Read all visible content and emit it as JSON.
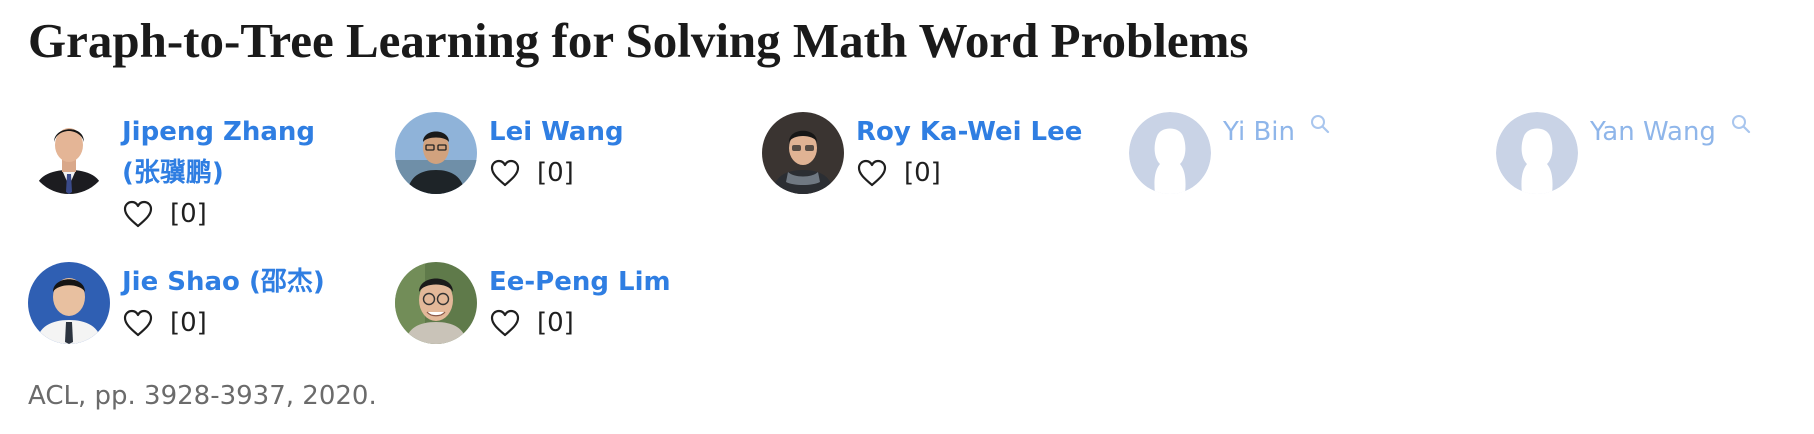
{
  "paper": {
    "title": "Graph-to-Tree Learning for Solving Math Word Problems",
    "venue": "ACL, pp. 3928-3937, 2020."
  },
  "authors": [
    {
      "name_line1": "Jipeng Zhang",
      "name_line2": "(张骥鹏)",
      "likes": "[0]",
      "photo": "man-in-suit-photo"
    },
    {
      "name_line1": "Lei Wang",
      "likes": "[0]",
      "photo": "man-with-glasses-outdoor-photo"
    },
    {
      "name_line1": "Roy Ka-Wei Lee",
      "likes": "[0]",
      "photo": "man-with-glasses-scarf-photo"
    },
    {
      "name_line1": "Yi Bin",
      "photo": "placeholder-avatar"
    },
    {
      "name_line1": "Yan Wang",
      "photo": "placeholder-avatar"
    },
    {
      "name_line1": "Jie Shao (邵杰)",
      "likes": "[0]",
      "photo": "man-blue-background-photo"
    },
    {
      "name_line1": "Ee-Peng Lim",
      "likes": "[0]",
      "photo": "smiling-man-glasses-photo"
    }
  ],
  "colors": {
    "author_link": "#2f7ee2",
    "author_link_unclaimed": "#8fb6ea",
    "placeholder_avatar": "#c9d3e6"
  }
}
